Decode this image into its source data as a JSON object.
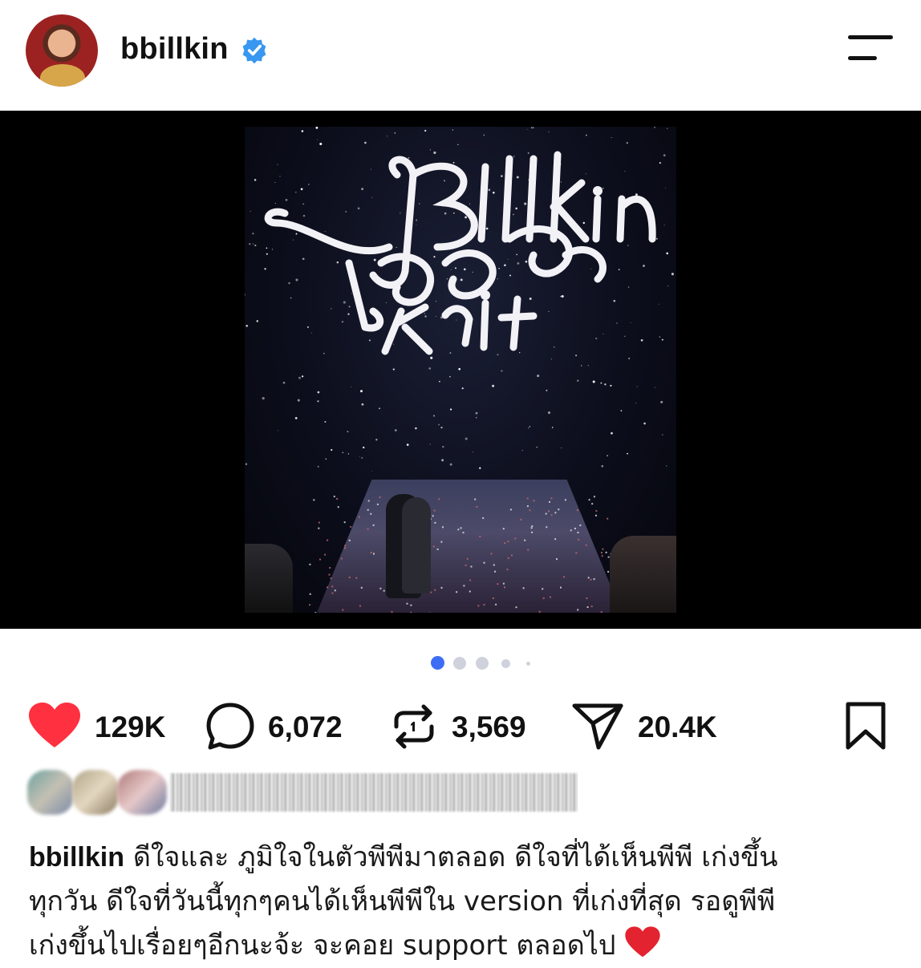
{
  "header": {
    "username": "bbillkin",
    "verified": true,
    "avatar_icon": "profile-avatar",
    "menu_icon": "menu-icon"
  },
  "post": {
    "image_alt_icons": [
      "concert-poster",
      "user-tag-icon"
    ],
    "carousel": {
      "total": 5,
      "active_index": 0
    }
  },
  "actions": {
    "likes": "129K",
    "comments": "6,072",
    "reposts": "3,569",
    "shares": "20.4K",
    "like_color": "#ff3040"
  },
  "caption": {
    "user": "bbillkin",
    "line1": "ดีใจและ ภูมิใจในตัวพีพีมาตลอด ดีใจที่ได้เห็นพีพี เก่งขึ้น",
    "line2": "ทุกวัน ดีใจที่วันนี้ทุกๆคนได้เห็นพีพีใน version ที่เก่งที่สุด รอดูพีพี",
    "line3": "เก่งขึ้นไปเรื่อยๆอีกนะจ้ะ จะคอย support ตลอดไป",
    "emoji": "red-heart"
  }
}
